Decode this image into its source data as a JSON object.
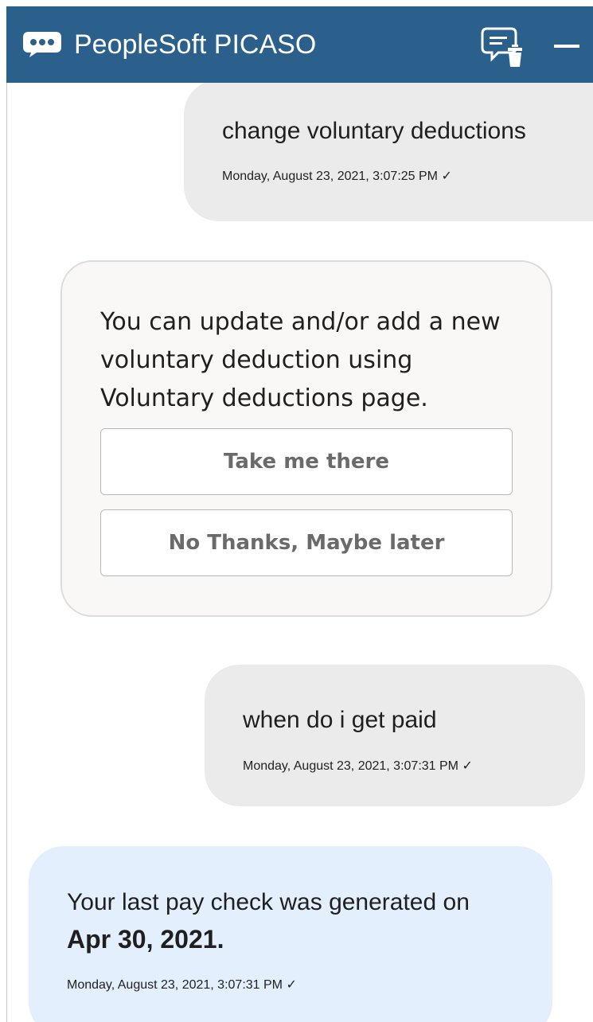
{
  "header": {
    "title": "PeopleSoft PICASO",
    "logo_icon": "chat-bubble-icon",
    "clear_icon": "clear-chat-icon",
    "minimize_icon": "minimize-icon",
    "background": "#2b5f8c"
  },
  "conversation": {
    "user_message_1": {
      "text": "change voluntary deductions",
      "timestamp": "Monday, August 23, 2021, 3:07:25 PM ✓"
    },
    "bot_message_1": {
      "text": "You can update and/or add a new voluntary deduction using Voluntary deductions page.",
      "option_1": "Take me there",
      "option_2": "No Thanks, Maybe later"
    },
    "user_message_2": {
      "text": "when do i get paid",
      "timestamp": "Monday, August 23, 2021, 3:07:31 PM ✓"
    },
    "bot_message_2": {
      "text": "Your last pay check was generated on",
      "date": "Apr 30, 2021.",
      "timestamp": "Monday, August 23, 2021, 3:07:31 PM ✓"
    }
  },
  "colors": {
    "user_bubble": "#ebebeb",
    "bot_card": "#f9f8f7",
    "bot_reply": "#e4effd"
  }
}
